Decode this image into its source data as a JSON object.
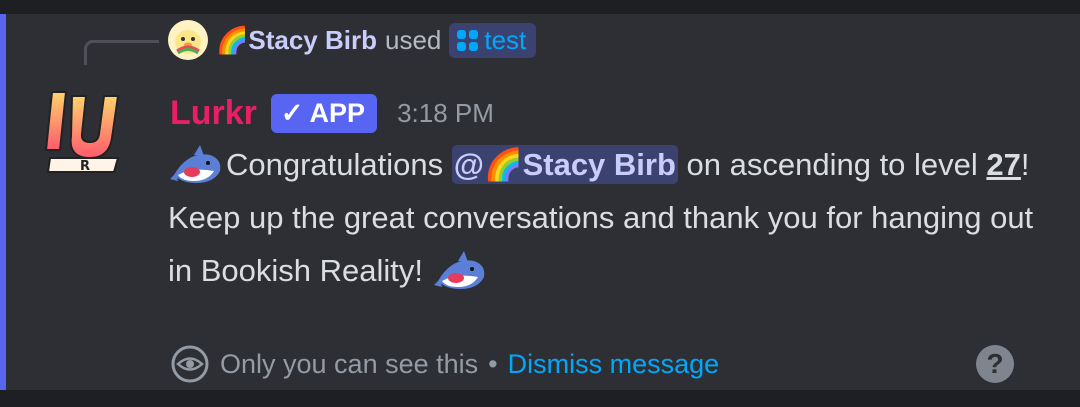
{
  "reply": {
    "user": "🌈Stacy Birb",
    "used": "used",
    "command": "test"
  },
  "message": {
    "bot_name": "Lurkr",
    "badge": "APP",
    "timestamp": "3:18 PM",
    "text_before_mention": "Congratulations ",
    "mention": "@🌈Stacy Birb",
    "text_after_mention": " on ascending to level ",
    "level": "27",
    "text_after_level": "! Keep up the great conversations and thank you for hanging out in Bookish Reality! "
  },
  "footer": {
    "visibility_text": "Only you can see this",
    "separator": "•",
    "dismiss_label": "Dismiss message",
    "help_label": "?"
  },
  "colors": {
    "accent": "#5865f2",
    "bot_name": "#e91e63",
    "link": "#00a8fc",
    "mention_bg": "#3c4270"
  }
}
